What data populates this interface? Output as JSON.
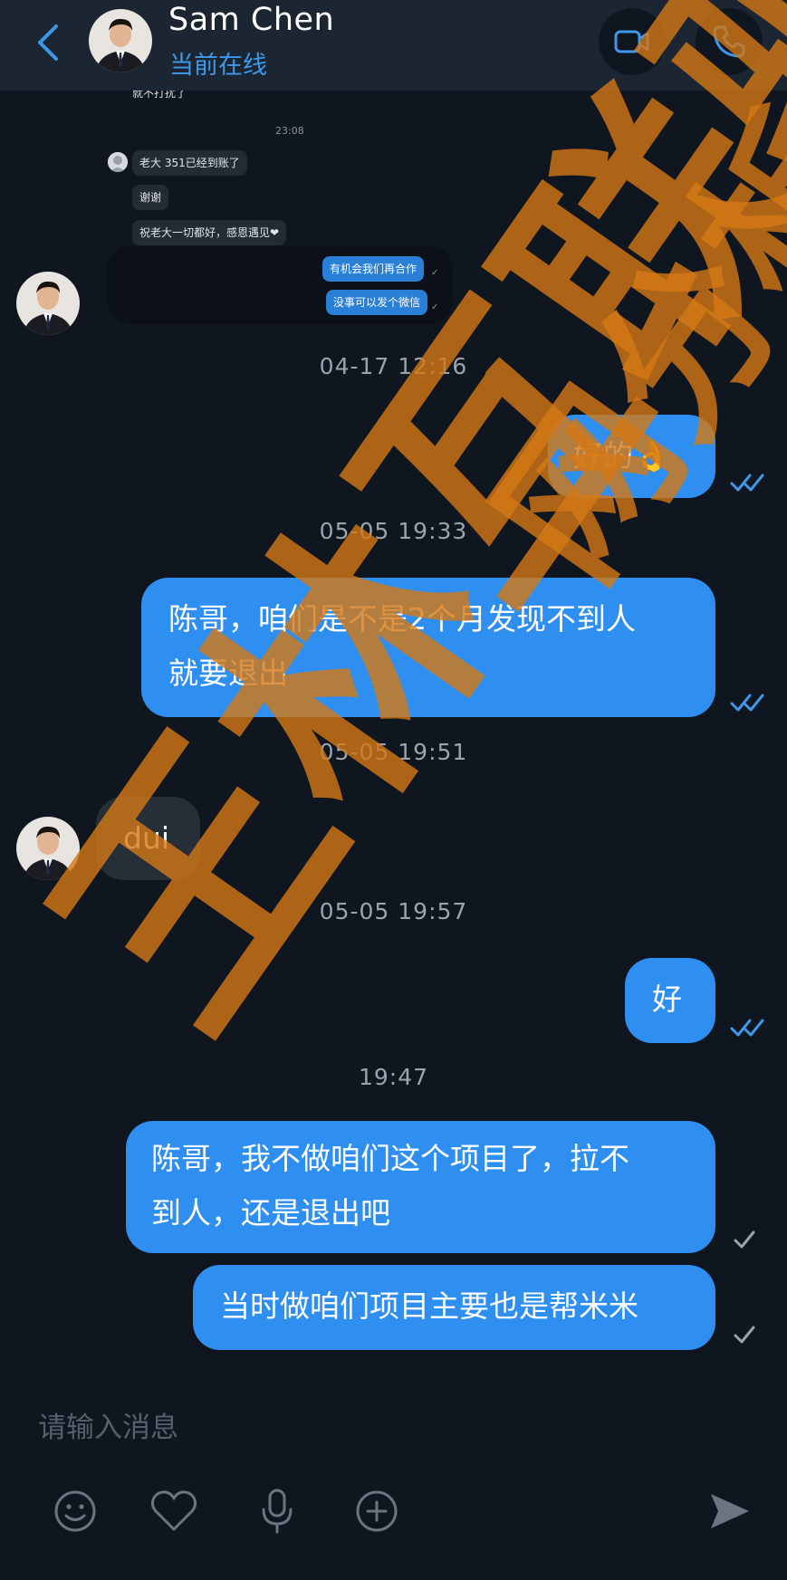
{
  "header": {
    "name": "Sam Chen",
    "status": "当前在线"
  },
  "embedded": {
    "top_text": "就不打扰了",
    "time": "23:08",
    "messages": [
      "老大 351已经到账了",
      "谢谢",
      "祝老大一切都好，感恩遇见❤"
    ],
    "replies": [
      "有机会我们再合作",
      "没事可以发个微信"
    ]
  },
  "timestamps": {
    "t1": "04-17 12:16",
    "t2": "05-05 19:33",
    "t3": "05-05 19:51",
    "t4": "05-05 19:57",
    "t5": "19:47"
  },
  "messages": {
    "m1": "好的👌",
    "m2_line1": "陈哥，咱们是不是2个月发现不到人",
    "m2_line2": "就要退出",
    "m3": "dui",
    "m4": "好",
    "m5_line1": "陈哥，我不做咱们这个项目了，拉不",
    "m5_line2": "到人，还是退出吧",
    "m6": "当时做咱们项目主要也是帮米米"
  },
  "input": {
    "placeholder": "请输入消息"
  },
  "watermark": {
    "text_left": "王林互联骗局",
    "text_right": "网分析"
  },
  "colors": {
    "accent": "#3f97e8",
    "outgoing_bubble": "#2e8ff0",
    "incoming_bubble": "#262e38",
    "background": "#101620",
    "watermark": "#d57814"
  }
}
